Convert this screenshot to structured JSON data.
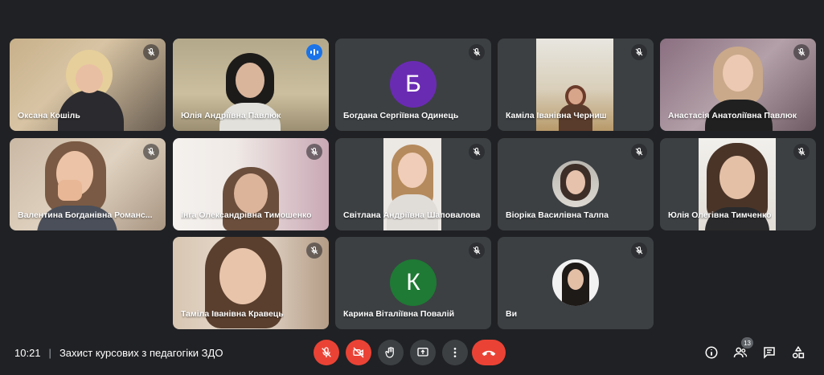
{
  "participants": [
    {
      "name": "Оксана Кошіль",
      "mic": "muted"
    },
    {
      "name": "Юлія Андріївна Павлюк",
      "mic": "speaking"
    },
    {
      "name": "Богдана Сергіївна Одинець",
      "mic": "muted",
      "avatar_letter": "Б",
      "avatar_color": "#6a2bb3"
    },
    {
      "name": "Каміла Іванівна Черниш",
      "mic": "muted"
    },
    {
      "name": "Анастасія Анатоліївна Павлюк",
      "mic": "muted"
    },
    {
      "name": "Валентина Богданівна Романс...",
      "mic": "muted"
    },
    {
      "name": "Інга Олександрівна Тимошенко",
      "mic": "muted"
    },
    {
      "name": "Світлана Андріївна Шаповалова",
      "mic": "muted"
    },
    {
      "name": "Віоріка Василівна Талпа",
      "mic": "muted"
    },
    {
      "name": "Юлія Олегівна Тимченко",
      "mic": "muted"
    },
    {
      "name": "Таміла Іванівна Кравець",
      "mic": "muted"
    },
    {
      "name": "Карина Віталіївна Повалій",
      "mic": "muted",
      "avatar_letter": "К",
      "avatar_color": "#1e7a34"
    },
    {
      "name": "Ви",
      "mic": "muted"
    }
  ],
  "bottom_bar": {
    "time": "10:21",
    "separator": "|",
    "meeting_title": "Захист курсових з педагогіки ЗДО",
    "participants_count": "13",
    "controls": [
      "mic-off-icon",
      "camera-off-icon",
      "raise-hand-icon",
      "present-screen-icon",
      "more-options-icon",
      "end-call-icon"
    ],
    "right_icons": [
      "info-icon",
      "people-icon",
      "chat-icon",
      "activities-icon"
    ]
  },
  "colors": {
    "background": "#202124",
    "tile": "#3c4043",
    "danger": "#ea4335",
    "active_outline": "#8ab4f8",
    "speaking": "#1a73e8"
  }
}
